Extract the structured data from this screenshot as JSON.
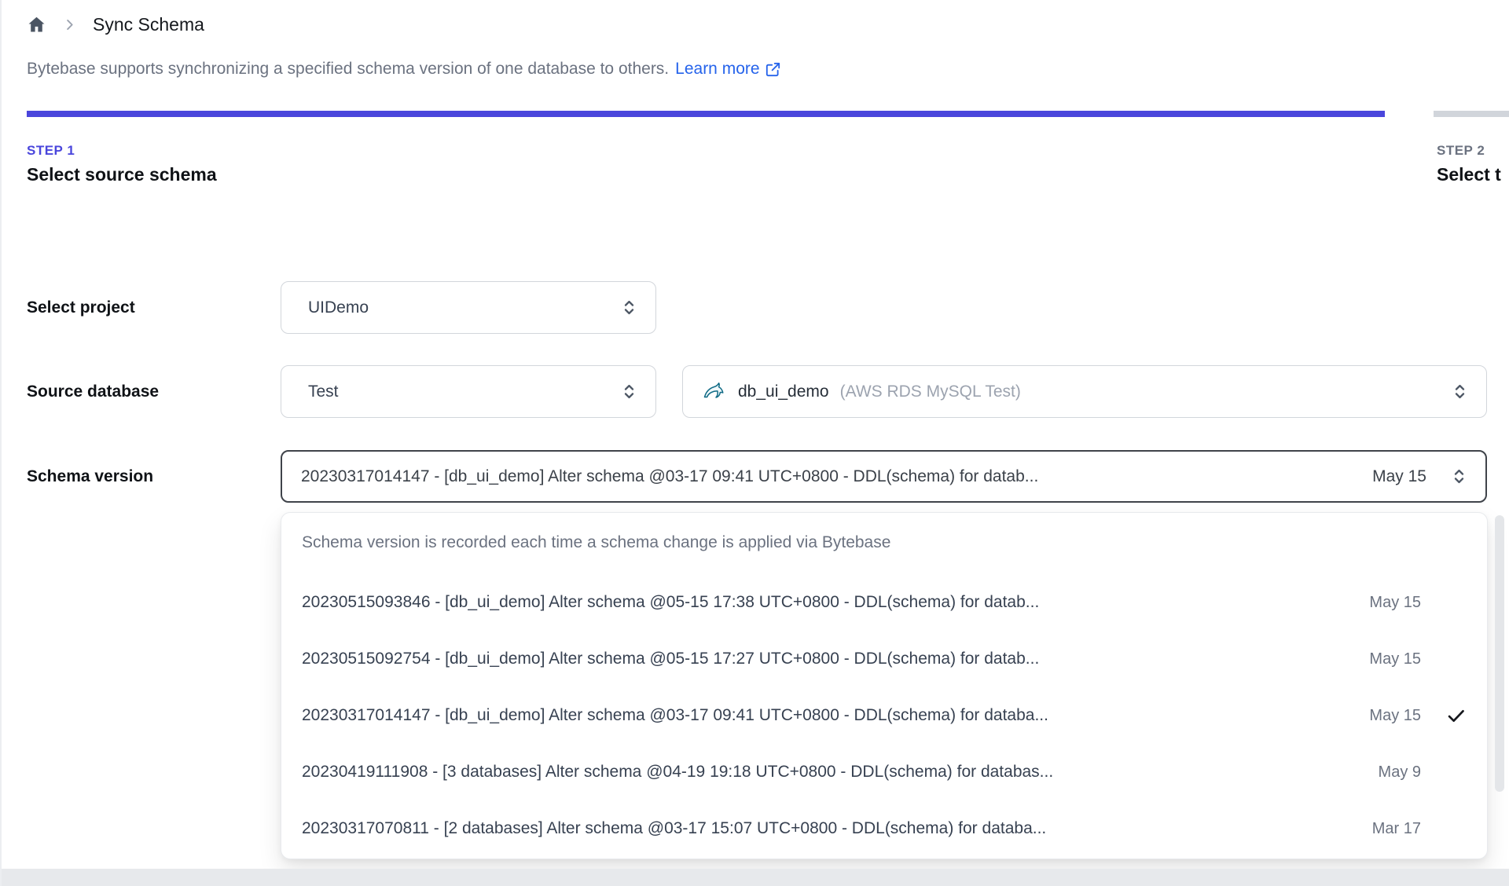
{
  "colors": {
    "accent_indigo": "#4a46dc",
    "link_blue": "#2563eb",
    "inactive_gray": "#d1d5db",
    "muted_text": "#6b7280",
    "dark_text": "#0f1216",
    "focus_border": "#3f434a",
    "mysql_teal": "#0f6a85"
  },
  "icons": {
    "breadcrumb_home": "home-icon",
    "breadcrumb_separator": "chevron-right-icon",
    "learn_more": "external-link-icon",
    "select_control": "chevron-up-down-icon",
    "database_engine": "mysql-dolphin-icon",
    "selected_option": "check-icon",
    "scrollbar": "scrollbar-thumb"
  },
  "breadcrumb": {
    "title": "Sync Schema"
  },
  "header": {
    "description": "Bytebase supports synchronizing a specified schema version of one database to others.",
    "learn_more_label": "Learn more"
  },
  "steps": [
    {
      "id": "STEP 1",
      "title": "Select source schema",
      "active": true
    },
    {
      "id": "STEP 2",
      "title": "Select t",
      "active": false
    }
  ],
  "form": {
    "project": {
      "label": "Select project",
      "value": "UIDemo"
    },
    "source_database": {
      "label": "Source database",
      "environment_value": "Test",
      "database_value": "db_ui_demo",
      "database_detail": "(AWS RDS MySQL Test)"
    },
    "schema_version": {
      "label": "Schema version",
      "value": "20230317014147 - [db_ui_demo] Alter schema @03-17 09:41 UTC+0800 - DDL(schema) for datab...",
      "date": "May 15"
    }
  },
  "dropdown": {
    "hint": "Schema version is recorded each time a schema change is applied via Bytebase",
    "options": [
      {
        "text": "20230515093846 - [db_ui_demo] Alter schema @05-15 17:38 UTC+0800 - DDL(schema) for datab...",
        "date": "May 15",
        "selected": false
      },
      {
        "text": "20230515092754 - [db_ui_demo] Alter schema @05-15 17:27 UTC+0800 - DDL(schema) for datab...",
        "date": "May 15",
        "selected": false
      },
      {
        "text": "20230317014147 - [db_ui_demo] Alter schema @03-17 09:41 UTC+0800 - DDL(schema) for databa...",
        "date": "May 15",
        "selected": true
      },
      {
        "text": "20230419111908 - [3 databases] Alter schema @04-19 19:18 UTC+0800 - DDL(schema) for databas...",
        "date": "May 9",
        "selected": false
      },
      {
        "text": "20230317070811 - [2 databases] Alter schema @03-17 15:07 UTC+0800 - DDL(schema) for databa...",
        "date": "Mar 17",
        "selected": false
      }
    ]
  }
}
